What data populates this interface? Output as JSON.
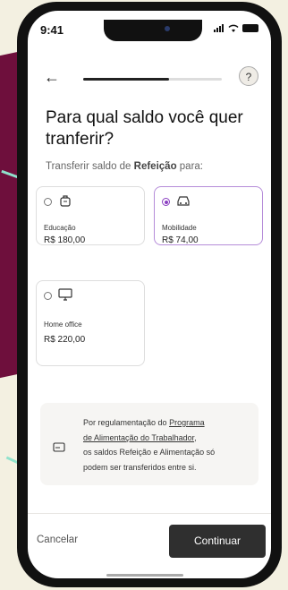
{
  "status": {
    "time": "9:41"
  },
  "nav": {
    "progress_fraction": 0.62
  },
  "header": {
    "title": "Para qual saldo você quer tranferir?",
    "subtitle_prefix": "Transferir saldo de ",
    "subtitle_bold": "Refeição",
    "subtitle_suffix": " para:"
  },
  "options": [
    {
      "label": "Educação",
      "value": "R$ 180,00",
      "icon": "backpack-icon",
      "selected": false
    },
    {
      "label": "Mobilidade",
      "value": "R$ 74,00",
      "icon": "car-icon",
      "selected": true
    },
    {
      "label": "Home office",
      "value": "R$ 220,00",
      "icon": "monitor-icon",
      "selected": false
    }
  ],
  "info": {
    "line1_prefix": "Por regulamentação do ",
    "line1_link": "Programa",
    "line2_link": "de Alimentação do Trabalhador",
    "line2_suffix": ",",
    "line3": "os saldos Refeição e Alimentação só",
    "line4": "podem ser transferidos entre si."
  },
  "footer": {
    "cancel_label": "Cancelar",
    "continue_label": "Continuar"
  },
  "colors": {
    "accent": "#8a3fc1",
    "selected_border": "#b58cd9",
    "button": "#2f2f2f"
  }
}
